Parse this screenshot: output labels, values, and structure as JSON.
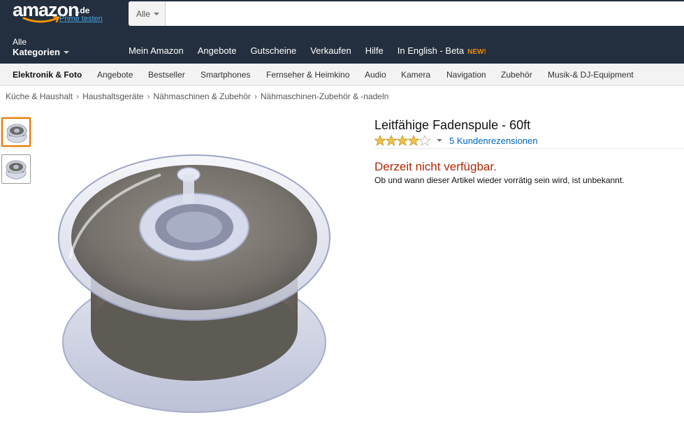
{
  "header": {
    "logo_word": "amazon",
    "logo_tld": ".de",
    "prime_link": "Prime testen",
    "search": {
      "department": "Alle",
      "placeholder": ""
    },
    "categories_small": "Alle",
    "categories_big": "Kategorien",
    "nav_links": [
      "Mein Amazon",
      "Angebote",
      "Gutscheine",
      "Verkaufen",
      "Hilfe",
      "In English - Beta"
    ],
    "new_badge": "NEW!"
  },
  "subnav": {
    "items": [
      "Elektronik & Foto",
      "Angebote",
      "Bestseller",
      "Smartphones",
      "Fernseher & Heimkino",
      "Audio",
      "Kamera",
      "Navigation",
      "Zubehör",
      "Musik-& DJ-Equipment"
    ]
  },
  "breadcrumb": [
    "Küche & Haushalt",
    "Haushaltsgeräte",
    "Nähmaschinen & Zubehör",
    "Nähmaschinen-Zubehör & -nadeln"
  ],
  "breadcrumb_separator": "›",
  "product": {
    "title": "Leitfähige Fadenspule - 60ft",
    "rating": 4,
    "rating_max": 5,
    "reviews": "5 Kundenrezensionen",
    "availability": "Derzeit nicht verfügbar.",
    "availability_note": "Ob und wann dieser Artikel wieder vorrätig sein wird, ist unbekannt."
  },
  "colors": {
    "header_bg": "#232f3e",
    "accent_orange": "#f08804",
    "link_blue": "#0066c0",
    "unavailable_red": "#b12704",
    "star_gold": "#f0c14b"
  }
}
